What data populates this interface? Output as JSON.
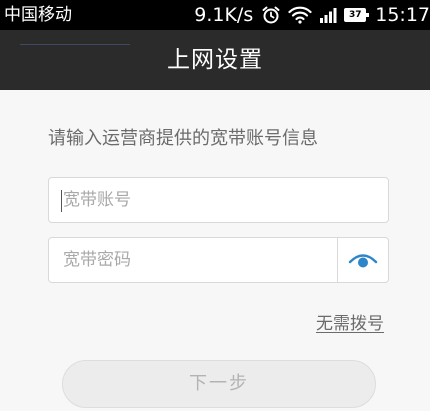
{
  "status_bar": {
    "carrier": "中国移动",
    "net_speed": "9.1K/s",
    "battery_level": "37",
    "time": "15:17",
    "icons": [
      "alarm-icon",
      "wifi-icon",
      "signal-icon",
      "battery-icon"
    ]
  },
  "header": {
    "title": "上网设置"
  },
  "form": {
    "instruction": "请输入运营商提供的宽带账号信息",
    "account_placeholder": "宽带账号",
    "password_placeholder": "宽带密码",
    "password_toggle_icon": "eye-icon",
    "skip_link": "无需拨号",
    "next_button": "下一步"
  },
  "colors": {
    "accent": "#2e86c8",
    "title_bar": "#2b2b2b"
  }
}
